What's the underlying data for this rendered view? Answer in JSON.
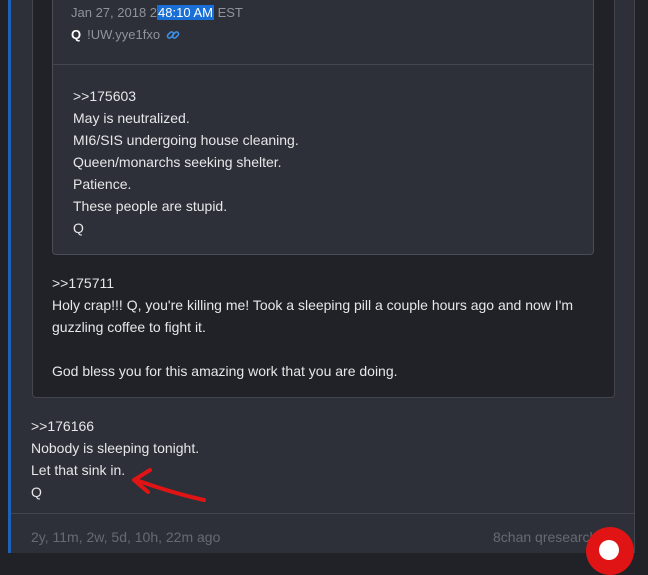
{
  "quoted_post": {
    "timestamp_prefix": "Jan 27, 2018 2",
    "timestamp_highlight": "48:10 AM",
    "timestamp_suffix": " EST",
    "author": "Q",
    "tripcode": "!UW.yye1fxo",
    "lines": [
      ">>175603",
      "May is neutralized.",
      "MI6/SIS undergoing house cleaning.",
      "Queen/monarchs seeking shelter.",
      "Patience.",
      "These people are stupid.",
      "Q"
    ]
  },
  "reply_post": {
    "lines": [
      ">>175711",
      "Holy crap!!! Q, you're killing me! Took a sleeping pill a couple hours ago and now I'm",
      "guzzling coffee to fight it.",
      "",
      "God bless you for this amazing work that you are doing."
    ]
  },
  "main_post": {
    "lines": [
      ">>176166",
      "Nobody is sleeping tonight.",
      "Let that sink in.",
      "Q"
    ]
  },
  "footer": {
    "age": "2y, 11m, 2w, 5d, 10h, 22m ago",
    "source": "8chan qresearch"
  },
  "colors": {
    "accent_blue": "#1e61b8",
    "highlight": "#1a6fd6",
    "link_icon": "#3d8fe6",
    "annotation_red": "#e01414"
  },
  "icons": {
    "permalink": "link-icon",
    "fab": "red-circle-button"
  }
}
